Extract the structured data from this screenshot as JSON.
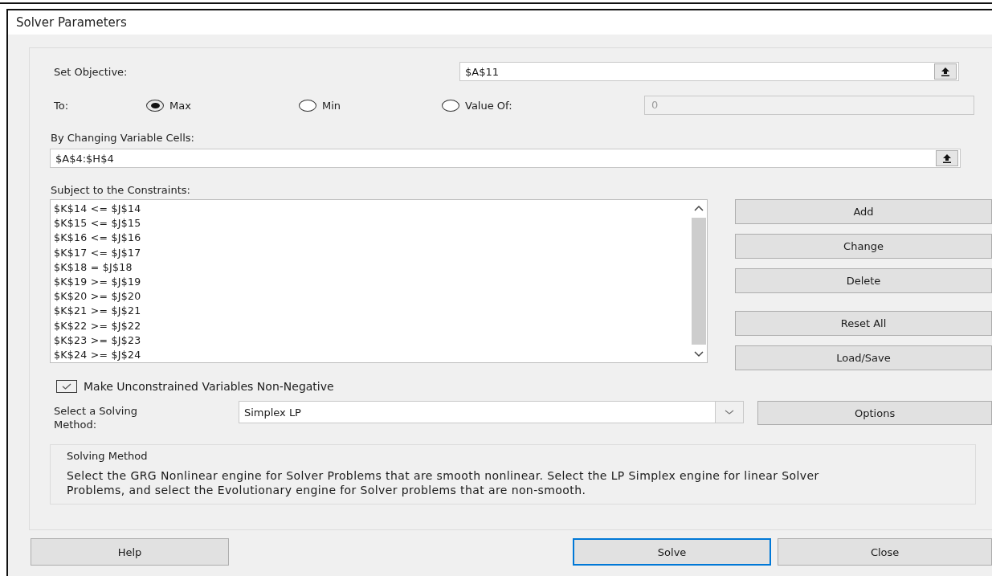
{
  "window": {
    "title": "Solver Parameters"
  },
  "objective": {
    "label": "Set Objective:",
    "value": "$A$11"
  },
  "to": {
    "label": "To:",
    "options": [
      {
        "label": "Max",
        "selected": true
      },
      {
        "label": "Min",
        "selected": false
      },
      {
        "label": "Value Of:",
        "selected": false
      }
    ],
    "value_of": {
      "value": "0",
      "disabled": true
    }
  },
  "variable_cells": {
    "label": "By Changing Variable Cells:",
    "value": "$A$4:$H$4"
  },
  "constraints": {
    "label": "Subject to the Constraints:",
    "items": [
      "$K$14 <= $J$14",
      "$K$15 <= $J$15",
      "$K$16 <= $J$16",
      "$K$17 <= $J$17",
      "$K$18 = $J$18",
      "$K$19 >= $J$19",
      "$K$20 >= $J$20",
      "$K$21 >= $J$21",
      "$K$22 >= $J$22",
      "$K$23 >= $J$23",
      "$K$24 >= $J$24"
    ]
  },
  "constraint_buttons": [
    {
      "label": "Add"
    },
    {
      "label": "Change"
    },
    {
      "label": "Delete"
    },
    {
      "label": "Reset All"
    },
    {
      "label": "Load/Save"
    }
  ],
  "non_negative": {
    "label": "Make Unconstrained Variables Non-Negative",
    "checked": true
  },
  "solving_method": {
    "label": "Select a Solving Method:",
    "value": "Simplex LP",
    "options_button": "Options"
  },
  "description": {
    "title": "Solving Method",
    "text": "Select the GRG Nonlinear engine for Solver Problems that are smooth nonlinear. Select the LP Simplex engine for linear Solver Problems, and select the Evolutionary engine for Solver problems that are non-smooth."
  },
  "footer_buttons": [
    {
      "label": "Help",
      "default": false
    },
    {
      "label": "Solve",
      "default": true
    },
    {
      "label": "Close",
      "default": false
    }
  ]
}
